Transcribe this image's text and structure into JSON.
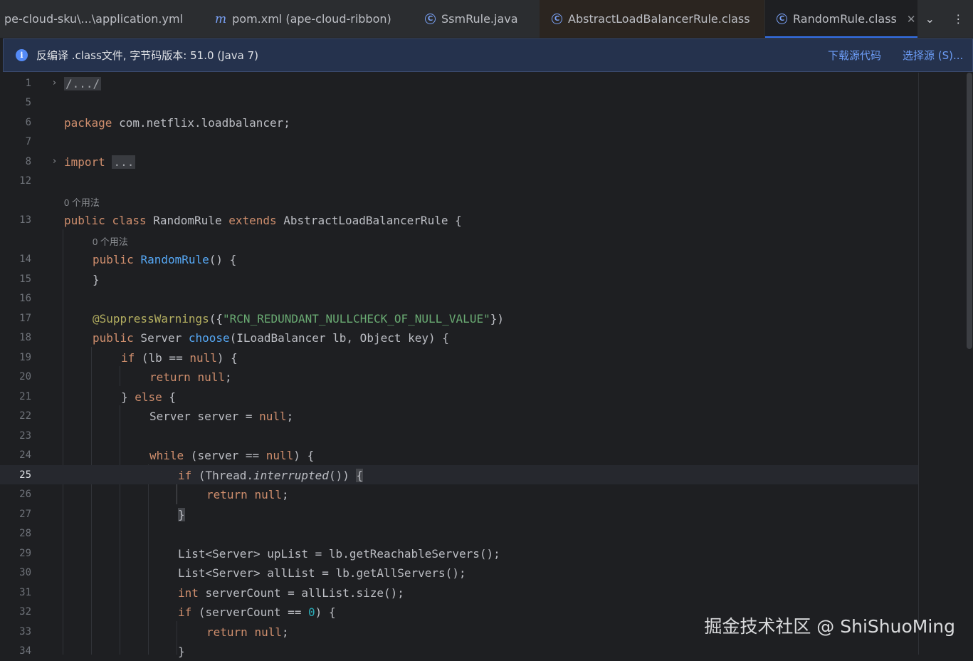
{
  "tabs": [
    {
      "label": "pe-cloud-sku\\...\\application.yml",
      "icon": "none",
      "active": false
    },
    {
      "label": "pom.xml (ape-cloud-ribbon)",
      "icon": "maven-m-icon",
      "active": false
    },
    {
      "label": "SsmRule.java",
      "icon": "class-c-icon",
      "active": false
    },
    {
      "label": "AbstractLoadBalancerRule.class",
      "icon": "class-c-icon",
      "active": false
    },
    {
      "label": "RandomRule.class",
      "icon": "class-c-icon",
      "active": true
    }
  ],
  "tabbar_actions": {
    "chevron": "⌄",
    "more": "⋮"
  },
  "banner": {
    "icon_glyph": "i",
    "text": "反编译 .class文件, 字节码版本: 51.0 (Java 7)",
    "download_link": "下载源代码",
    "choose_link": "选择源 (S)..."
  },
  "editor": {
    "current_line": "25",
    "usages_hint": "0 个用法",
    "line_numbers": [
      "1",
      "5",
      "6",
      "7",
      "8",
      "12",
      "13",
      "14",
      "15",
      "16",
      "17",
      "18",
      "19",
      "20",
      "21",
      "22",
      "23",
      "24",
      "25",
      "26",
      "27",
      "28",
      "29",
      "30",
      "31",
      "32",
      "33",
      "34"
    ],
    "code": {
      "l1_fold": "/.../",
      "l6_kw": "package",
      "l6_rest": " com.netflix.loadbalancer;",
      "l8_kw": "import",
      "l8_fold": "...",
      "l13_kw1": "public",
      "l13_kw2": "class",
      "l13_name": " RandomRule ",
      "l13_kw3": "extends",
      "l13_rest": " AbstractLoadBalancerRule {",
      "l14_kw": "public",
      "l14_fn": "RandomRule",
      "l14_rest": "() {",
      "l15": "}",
      "l17_ann": "@SuppressWarnings",
      "l17_p1": "({",
      "l17_str": "\"RCN_REDUNDANT_NULLCHECK_OF_NULL_VALUE\"",
      "l17_p2": "})",
      "l18_kw": "public",
      "l18_type": " Server ",
      "l18_fn": "choose",
      "l18_rest": "(ILoadBalancer lb, Object key) {",
      "l19_kw": "if",
      "l19_a": " (lb == ",
      "l19_null": "null",
      "l19_b": ") {",
      "l20_kw": "return",
      "l20_null": "null",
      "l20_semi": ";",
      "l21_a": "} ",
      "l21_kw": "else",
      "l21_b": " {",
      "l22_a": "Server server = ",
      "l22_null": "null",
      "l22_semi": ";",
      "l24_kw": "while",
      "l24_a": " (server == ",
      "l24_null": "null",
      "l24_b": ") {",
      "l25_kw": "if",
      "l25_a": " (Thread.",
      "l25_ital": "interrupted",
      "l25_b": "()) ",
      "l25_brace": "{",
      "l26_kw": "return",
      "l26_null": "null",
      "l26_semi": ";",
      "l27_brace": "}",
      "l29": "List<Server> upList = lb.getReachableServers();",
      "l30": "List<Server> allList = lb.getAllServers();",
      "l31_kw": "int",
      "l31_rest": " serverCount = allList.size();",
      "l32_kw": "if",
      "l32_a": " (serverCount == ",
      "l32_num": "0",
      "l32_b": ") {",
      "l33_kw": "return",
      "l33_null": "null",
      "l33_semi": ";",
      "l34": "}"
    }
  },
  "watermark": "掘金技术社区 @ ShiShuoMing"
}
